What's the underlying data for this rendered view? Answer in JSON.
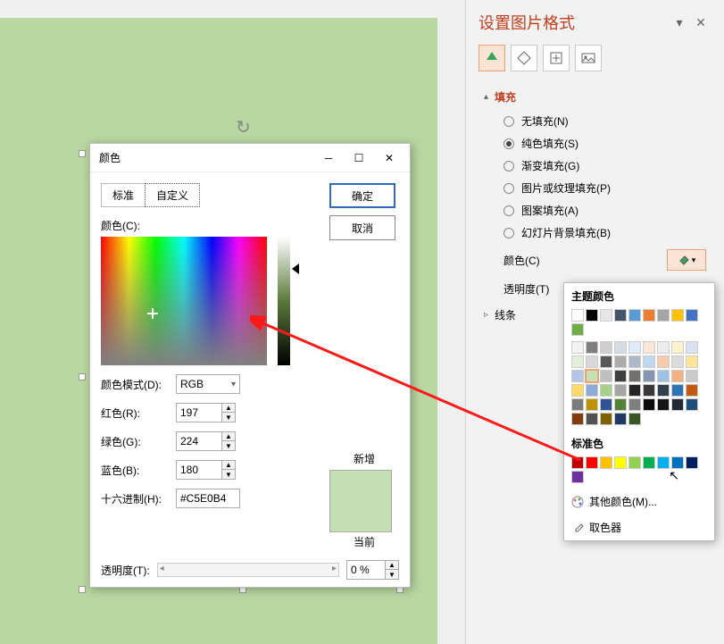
{
  "canvas": {
    "bg": "#b8d7a1"
  },
  "dialog": {
    "title": "颜色",
    "tabs": {
      "standard": "标准",
      "custom": "自定义"
    },
    "color_label": "颜色(C):",
    "model_label": "颜色模式(D):",
    "model_value": "RGB",
    "r_label": "红色(R):",
    "r_value": "197",
    "g_label": "绿色(G):",
    "g_value": "224",
    "b_label": "蓝色(B):",
    "b_value": "180",
    "hex_label": "十六进制(H):",
    "hex_value": "#C5E0B4",
    "transparency_label": "透明度(T):",
    "transparency_value": "0 %",
    "ok": "确定",
    "cancel": "取消",
    "new_label": "新增",
    "current_label": "当前",
    "preview_new": "#C5E0B4",
    "preview_current": "#C5E0B4"
  },
  "panel": {
    "title": "设置图片格式",
    "sections": {
      "fill": {
        "name": "填充",
        "options": {
          "none": "无填充(N)",
          "solid": "纯色填充(S)",
          "gradient": "渐变填充(G)",
          "picture": "图片或纹理填充(P)",
          "pattern": "图案填充(A)",
          "slidebg": "幻灯片背景填充(B)"
        },
        "color_label": "颜色(C)",
        "transparency_label": "透明度(T)"
      },
      "line": {
        "name": "线条"
      }
    }
  },
  "flyout": {
    "theme_header": "主题颜色",
    "standard_header": "标准色",
    "more_colors": "其他颜色(M)...",
    "eyedropper": "取色器",
    "theme_row1": [
      "#ffffff",
      "#000000",
      "#e7e6e6",
      "#44546a",
      "#5b9bd5",
      "#ed7d31",
      "#a5a5a5",
      "#ffc000",
      "#4472c4",
      "#70ad47"
    ],
    "theme_variants": [
      [
        "#f2f2f2",
        "#7f7f7f",
        "#d0cece",
        "#d6dce4",
        "#deebf6",
        "#fbe5d5",
        "#ededed",
        "#fff2cc",
        "#d9e2f3",
        "#e2efd9"
      ],
      [
        "#d8d8d8",
        "#595959",
        "#aeabab",
        "#adb9ca",
        "#bdd7ee",
        "#f7cbac",
        "#dbdbdb",
        "#fee599",
        "#b4c6e7",
        "#c5e0b4"
      ],
      [
        "#bfbfbf",
        "#3f3f3f",
        "#757070",
        "#8496b0",
        "#9cc3e5",
        "#f4b183",
        "#c9c9c9",
        "#ffd965",
        "#8eaadb",
        "#a8d08d"
      ],
      [
        "#a5a5a5",
        "#262626",
        "#3a3838",
        "#323f4f",
        "#2e75b5",
        "#c55a11",
        "#7b7b7b",
        "#bf9000",
        "#2f5496",
        "#538135"
      ],
      [
        "#7f7f7f",
        "#0c0c0c",
        "#171616",
        "#222a35",
        "#1e4e79",
        "#833c0b",
        "#525252",
        "#7f6000",
        "#1f3864",
        "#375623"
      ]
    ],
    "standard_colors": [
      "#c00000",
      "#ff0000",
      "#ffc000",
      "#ffff00",
      "#92d050",
      "#00b050",
      "#00b0f0",
      "#0070c0",
      "#002060",
      "#7030a0"
    ]
  }
}
